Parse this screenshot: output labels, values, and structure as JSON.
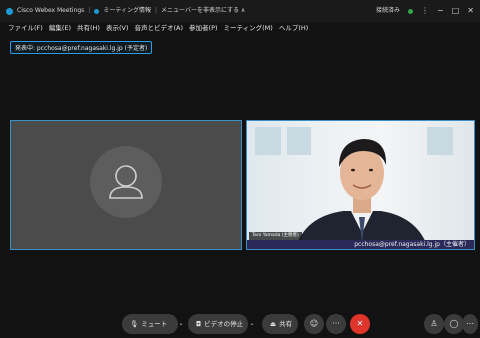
{
  "titlebar": {
    "app_name": "Cisco Webex Meetings",
    "meeting_info": "ミーティング情報",
    "menu_hint": "メニューバーを非表示にする ∧",
    "status": "接続済み"
  },
  "menu": [
    "ファイル(F)",
    "編集(E)",
    "共有(H)",
    "表示(V)",
    "音声とビデオ(A)",
    "参加者(P)",
    "ミーティング(M)",
    "ヘルプ(H)"
  ],
  "sharing_badge": "発表中: pcchosa@pref.nagasaki.lg.jp (予定者)",
  "video": {
    "name_tag": "Taro Yamada (主催者)",
    "email_label": "pcchosa@pref.nagasaki.lg.jp（主催者）"
  },
  "controls": {
    "mute_label": "ミュート",
    "video_label": "ビデオの停止",
    "share_label": "共有"
  },
  "colors": {
    "accent": "#2d9ce0",
    "end_call": "#e0352b",
    "connected": "#3aa54b"
  }
}
